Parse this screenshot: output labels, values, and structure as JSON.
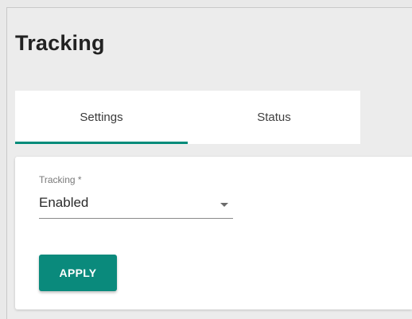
{
  "page": {
    "title": "Tracking"
  },
  "tabs": [
    {
      "label": "Settings",
      "active": true
    },
    {
      "label": "Status",
      "active": false
    }
  ],
  "form": {
    "tracking_field": {
      "label": "Tracking *",
      "value": "Enabled"
    },
    "apply_label": "APPLY"
  },
  "colors": {
    "accent": "#008b7a",
    "button": "#0a8a7c",
    "background": "#ececec"
  }
}
